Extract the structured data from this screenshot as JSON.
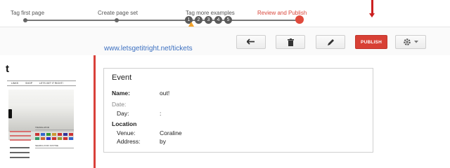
{
  "wizard": {
    "steps": [
      {
        "label": "Tag first page",
        "state": "done"
      },
      {
        "label": "Create page set",
        "state": "done"
      },
      {
        "label": "Tag more examples",
        "state": "done"
      },
      {
        "label": "Review and Publish",
        "state": "current"
      }
    ],
    "example_numbers": [
      "1",
      "2",
      "3",
      "4",
      "5"
    ],
    "active_color": "#d9463a"
  },
  "toolbar": {
    "undo_icon": "undo-arrow-icon",
    "delete_icon": "trash-icon",
    "edit_icon": "pencil-icon",
    "publish_label": "PUBLISH",
    "settings_icon": "gear-icon",
    "publish_color": "#d84035"
  },
  "thumbnail": {
    "title": "t",
    "nav_items": [
      "LINKS",
      "SHOP",
      "LETS GET IT RIGHT!"
    ],
    "sidebar_heading_1": "TRANSLATOR",
    "sidebar_heading_2": "SEARCH FOR JUSTINE"
  },
  "content": {
    "url": "www.letsgetitright.net/tickets",
    "card": {
      "title": "Event",
      "fields": {
        "name_label": "Name:",
        "name_value": "out!",
        "date_label": "Date:",
        "day_label": "Day:",
        "day_value": ":",
        "location_label": "Location",
        "venue_label": "Venue:",
        "venue_value": "Coraline",
        "address_label": "Address:",
        "address_value": "by"
      }
    }
  }
}
